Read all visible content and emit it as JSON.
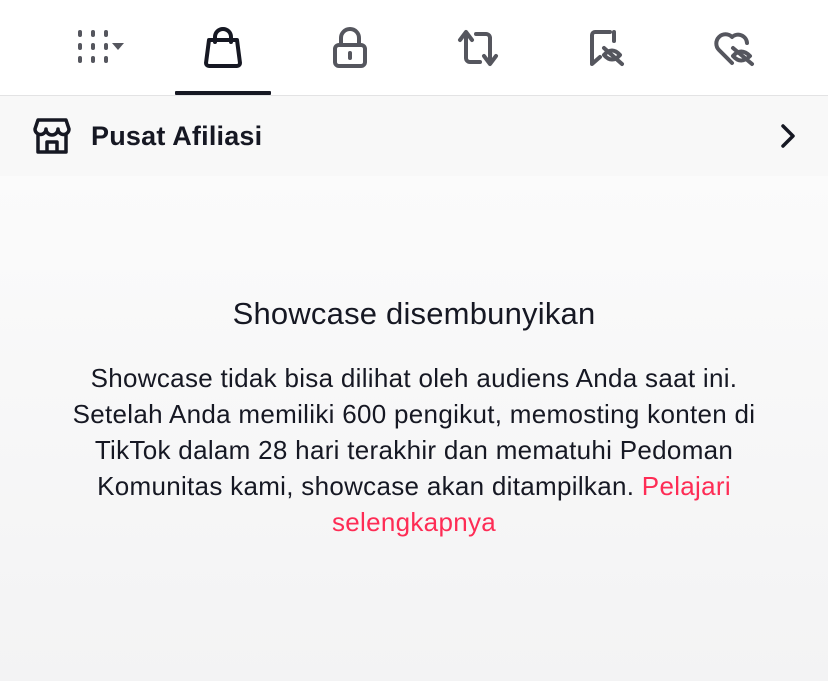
{
  "tabs": [
    {
      "name": "tab-grid",
      "icon": "grid-dropdown-icon"
    },
    {
      "name": "tab-shop",
      "icon": "shopping-bag-icon",
      "active": true
    },
    {
      "name": "tab-private",
      "icon": "lock-icon"
    },
    {
      "name": "tab-reposts",
      "icon": "repost-icon"
    },
    {
      "name": "tab-favorites",
      "icon": "bookmark-hidden-icon"
    },
    {
      "name": "tab-liked",
      "icon": "heart-hidden-icon"
    }
  ],
  "affiliate": {
    "icon": "storefront-icon",
    "label": "Pusat Afiliasi",
    "chevron_icon": "chevron-right-icon"
  },
  "empty_state": {
    "title": "Showcase disembunyikan",
    "body": "Showcase tidak bisa dilihat oleh audiens Anda saat ini. Setelah Anda memiliki 600 pengikut, memosting konten di TikTok dalam 28 hari terakhir dan mematuhi Pedoman Komunitas kami, showcase akan ditampilkan. ",
    "link": "Pelajari selengkapnya"
  },
  "colors": {
    "text_primary": "#161823",
    "icon_inactive": "#55565e",
    "link": "#fe2c55",
    "row_background": "#f8f8f8"
  }
}
